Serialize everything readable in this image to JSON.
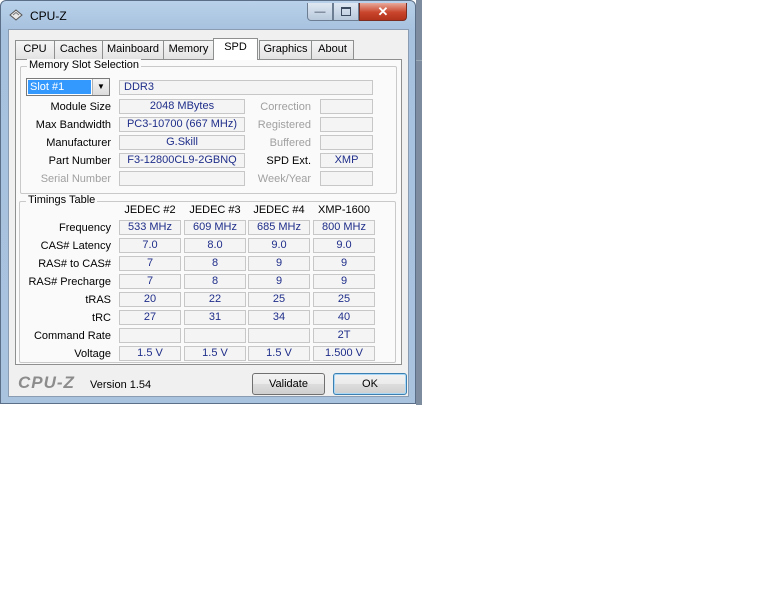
{
  "window": {
    "title": "CPU-Z"
  },
  "tabs": [
    "CPU",
    "Caches",
    "Mainboard",
    "Memory",
    "SPD",
    "Graphics",
    "About"
  ],
  "active_tab": "SPD",
  "memory_slot": {
    "group_title": "Memory Slot Selection",
    "selected_slot": "Slot #1",
    "memory_type": "DDR3",
    "fields": {
      "module_size": {
        "label": "Module Size",
        "value": "2048 MBytes"
      },
      "max_bandwidth": {
        "label": "Max Bandwidth",
        "value": "PC3-10700 (667 MHz)"
      },
      "manufacturer": {
        "label": "Manufacturer",
        "value": "G.Skill"
      },
      "part_number": {
        "label": "Part Number",
        "value": "F3-12800CL9-2GBNQ"
      },
      "serial_number": {
        "label": "Serial Number",
        "value": ""
      },
      "correction": {
        "label": "Correction",
        "value": ""
      },
      "registered": {
        "label": "Registered",
        "value": ""
      },
      "buffered": {
        "label": "Buffered",
        "value": ""
      },
      "spd_ext": {
        "label": "SPD Ext.",
        "value": "XMP"
      },
      "week_year": {
        "label": "Week/Year",
        "value": ""
      }
    }
  },
  "timings": {
    "group_title": "Timings Table",
    "columns": [
      "JEDEC #2",
      "JEDEC #3",
      "JEDEC #4",
      "XMP-1600"
    ],
    "rows": [
      {
        "label": "Frequency",
        "values": [
          "533 MHz",
          "609 MHz",
          "685 MHz",
          "800 MHz"
        ]
      },
      {
        "label": "CAS# Latency",
        "values": [
          "7.0",
          "8.0",
          "9.0",
          "9.0"
        ]
      },
      {
        "label": "RAS# to CAS#",
        "values": [
          "7",
          "8",
          "9",
          "9"
        ]
      },
      {
        "label": "RAS# Precharge",
        "values": [
          "7",
          "8",
          "9",
          "9"
        ]
      },
      {
        "label": "tRAS",
        "values": [
          "20",
          "22",
          "25",
          "25"
        ]
      },
      {
        "label": "tRC",
        "values": [
          "27",
          "31",
          "34",
          "40"
        ]
      },
      {
        "label": "Command Rate",
        "values": [
          "",
          "",
          "",
          "2T"
        ]
      },
      {
        "label": "Voltage",
        "values": [
          "1.5 V",
          "1.5 V",
          "1.5 V",
          "1.500 V"
        ]
      }
    ]
  },
  "footer": {
    "logo": "CPU-Z",
    "version": "Version 1.54",
    "validate_label": "Validate",
    "ok_label": "OK"
  }
}
